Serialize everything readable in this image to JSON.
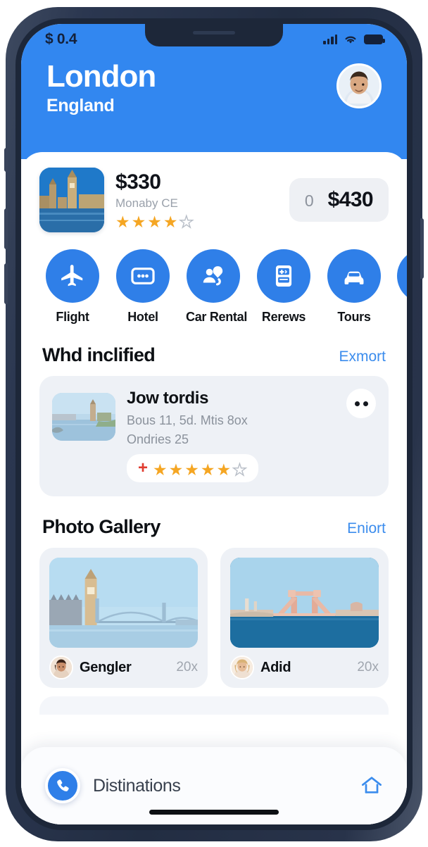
{
  "status_bar": {
    "time": "$ 0.4",
    "icons": [
      "signal-bars-icon",
      "wifi-icon",
      "battery-icon"
    ]
  },
  "header": {
    "city": "London",
    "country": "England",
    "avatar": "user-avatar",
    "bg_color": "#3287f0"
  },
  "price_card": {
    "thumbnail": "big-ben-thumbnail",
    "amount": "$330",
    "subtitle": "Monaby CE",
    "rating_filled": 4,
    "rating_total": 5,
    "pill": {
      "count": "0",
      "price": "$430"
    }
  },
  "categories": [
    {
      "label": "Flight",
      "icon": "airplane-icon"
    },
    {
      "label": "Hotel",
      "icon": "card-icon"
    },
    {
      "label": "Car Rental",
      "icon": "location-person-icon"
    },
    {
      "label": "Rerews",
      "icon": "document-icon"
    },
    {
      "label": "Tours",
      "icon": "car-icon"
    },
    {
      "label": "",
      "icon": "partial-icon"
    }
  ],
  "recommend_section": {
    "title": "Whd inclified",
    "link": "Exmort",
    "card": {
      "thumbnail": "river-tower-thumbnail",
      "title": "Jow tordis",
      "line1": "Bous 11, 5d. Mtis 8ox",
      "line2": "Ondries 25",
      "plus": "+",
      "rating_filled": 5,
      "rating_total": 6,
      "more_button": "more-options-icon"
    }
  },
  "gallery_section": {
    "title": "Photo Gallery",
    "link": "Eniort",
    "items": [
      {
        "photo": "bridge-bigben-photo",
        "name": "Gengler",
        "count": "20х"
      },
      {
        "photo": "pink-bridge-photo",
        "name": "Adid",
        "count": "20х"
      }
    ]
  },
  "bottom_bar": {
    "phone_icon": "phone-icon",
    "label": "Distinations",
    "home_icon": "home-icon"
  },
  "colors": {
    "accent": "#3287f0",
    "icon_blue": "#2f7fe8",
    "link_blue": "#3b8ced",
    "star_gold": "#f5a623",
    "plus_red": "#e03b2f",
    "card_gray": "#eef1f6",
    "bezel": "#2b3750"
  }
}
